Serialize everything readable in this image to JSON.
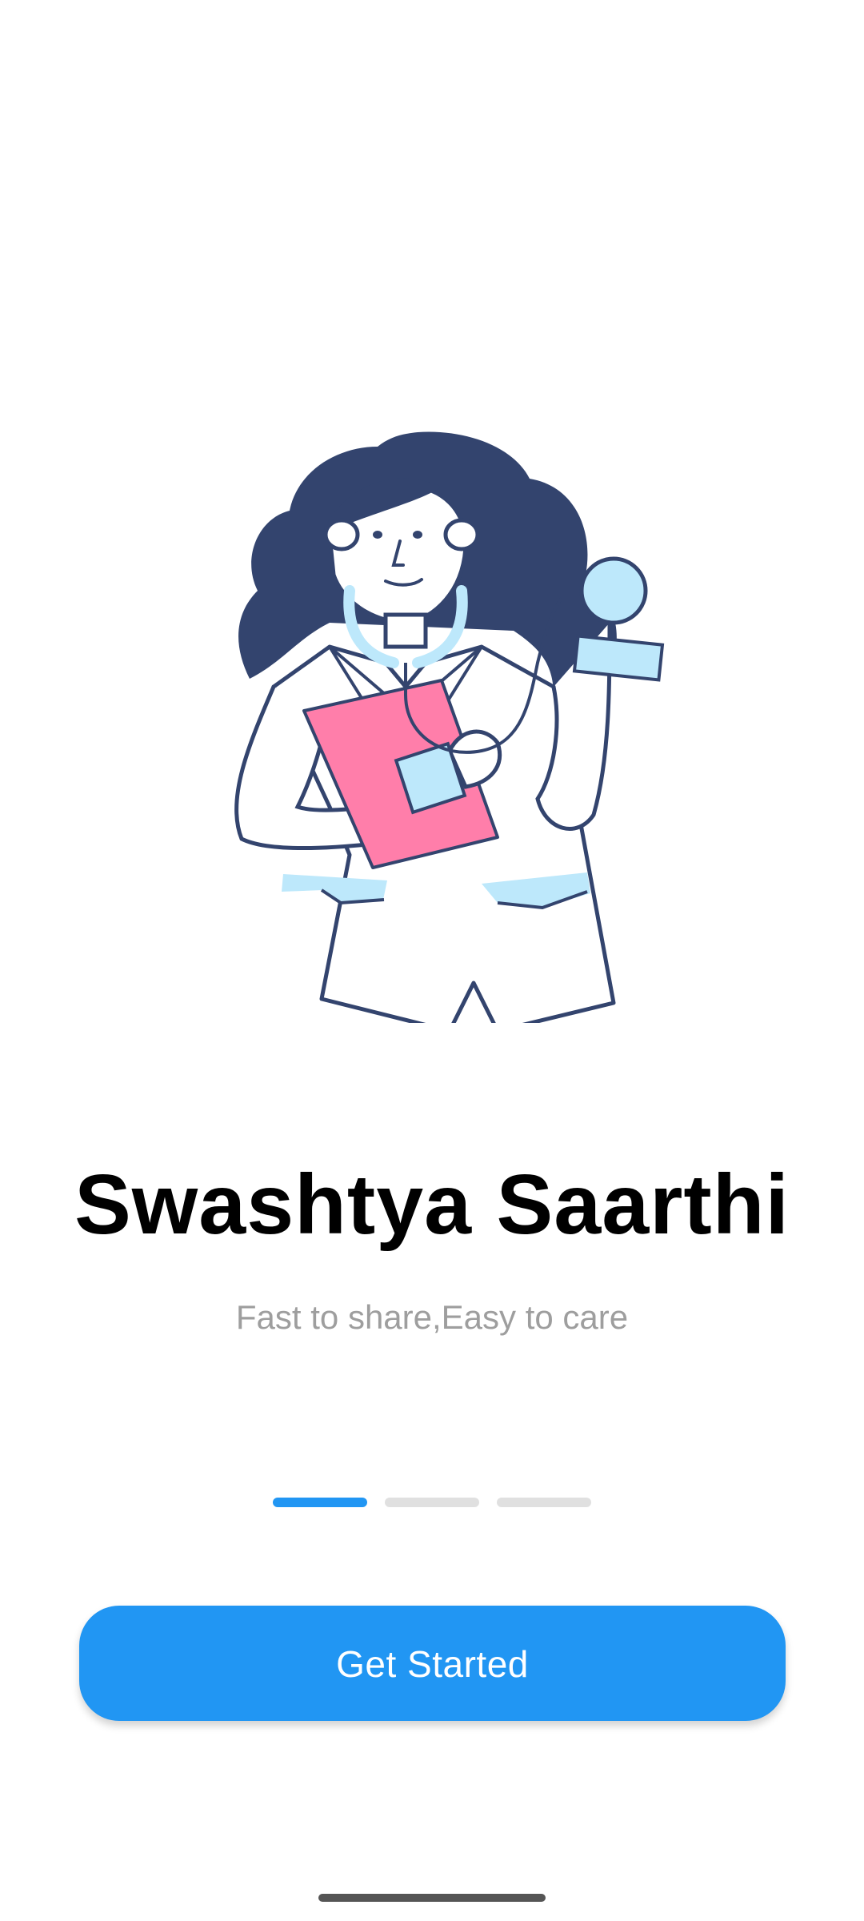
{
  "onboarding": {
    "title": "Swashtya Saarthi",
    "tagline": "Fast to share,Easy to care",
    "illustration": "doctor-with-stethoscope-and-clipboard",
    "pager": {
      "total": 3,
      "active_index": 0
    },
    "cta_label": "Get Started"
  },
  "colors": {
    "primary": "#2196f3",
    "title_text": "#000000",
    "tagline_text": "#9e9e9e",
    "hair": "#33446e",
    "clipboard": "#ff7eaa",
    "accent_light_blue": "#bde8fb",
    "outline": "#33446e"
  }
}
